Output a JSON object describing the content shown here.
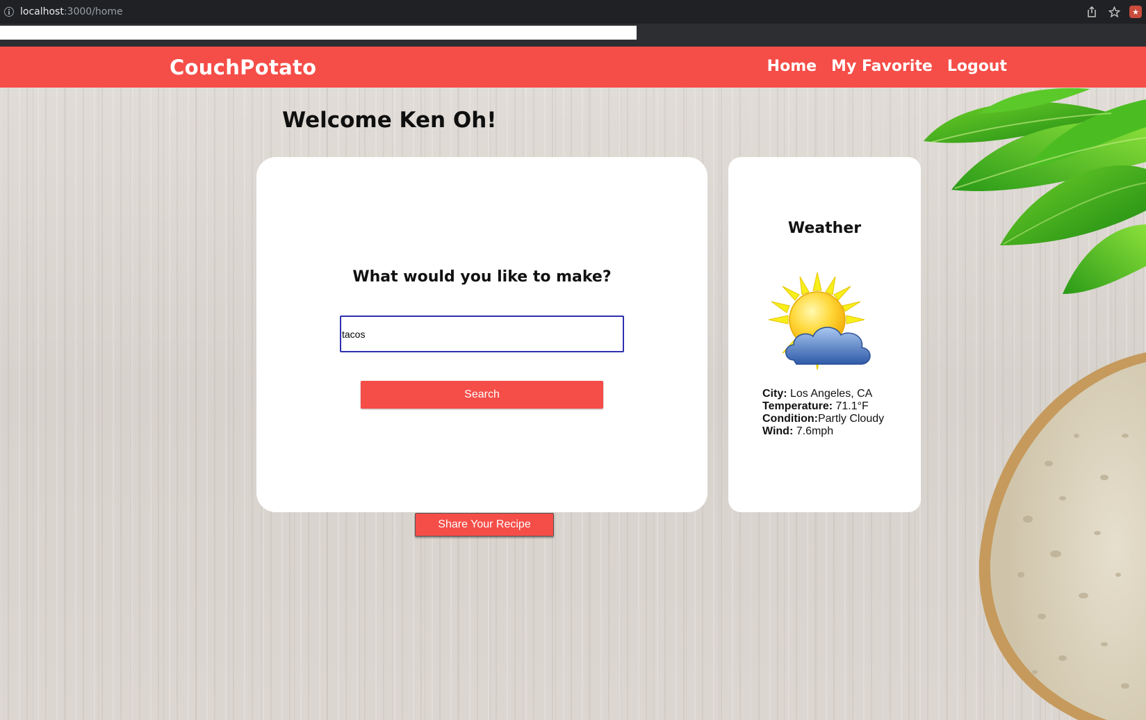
{
  "browser": {
    "url_host": "localhost",
    "url_path": ":3000/home",
    "icons": [
      "info-icon",
      "share-icon",
      "bookmark-star-icon",
      "extension-icon"
    ]
  },
  "navbar": {
    "brand": "CouchPotato",
    "links": [
      "Home",
      "My Favorite",
      "Logout"
    ],
    "color": "#f54d48"
  },
  "welcome": "Welcome Ken Oh!",
  "search": {
    "question": "What would you like to make?",
    "value": "tacos",
    "button_label": "Search"
  },
  "weather": {
    "title": "Weather",
    "icon": "partly-cloudy-icon",
    "city_label": "City:",
    "city_value": " Los Angeles, CA",
    "temp_label": "Temperature:",
    "temp_value": " 71.1°F",
    "condition_label": "Condition:",
    "condition_value": "Partly Cloudy",
    "wind_label": "Wind:",
    "wind_value": " 7.6mph"
  },
  "share_button_label": "Share Your Recipe"
}
